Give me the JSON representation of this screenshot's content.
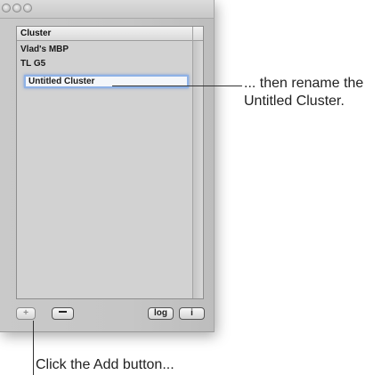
{
  "window": {
    "table": {
      "column_header": "Cluster",
      "rows": [
        "Vlad's MBP",
        "TL G5"
      ],
      "editing_row": "Untitled Cluster"
    },
    "buttons": {
      "add_label": "+",
      "log_label": "log",
      "info_label": "i"
    }
  },
  "callouts": {
    "rename_line1": "... then rename the",
    "rename_line2": "Untitled Cluster.",
    "add": "Click the Add button..."
  }
}
